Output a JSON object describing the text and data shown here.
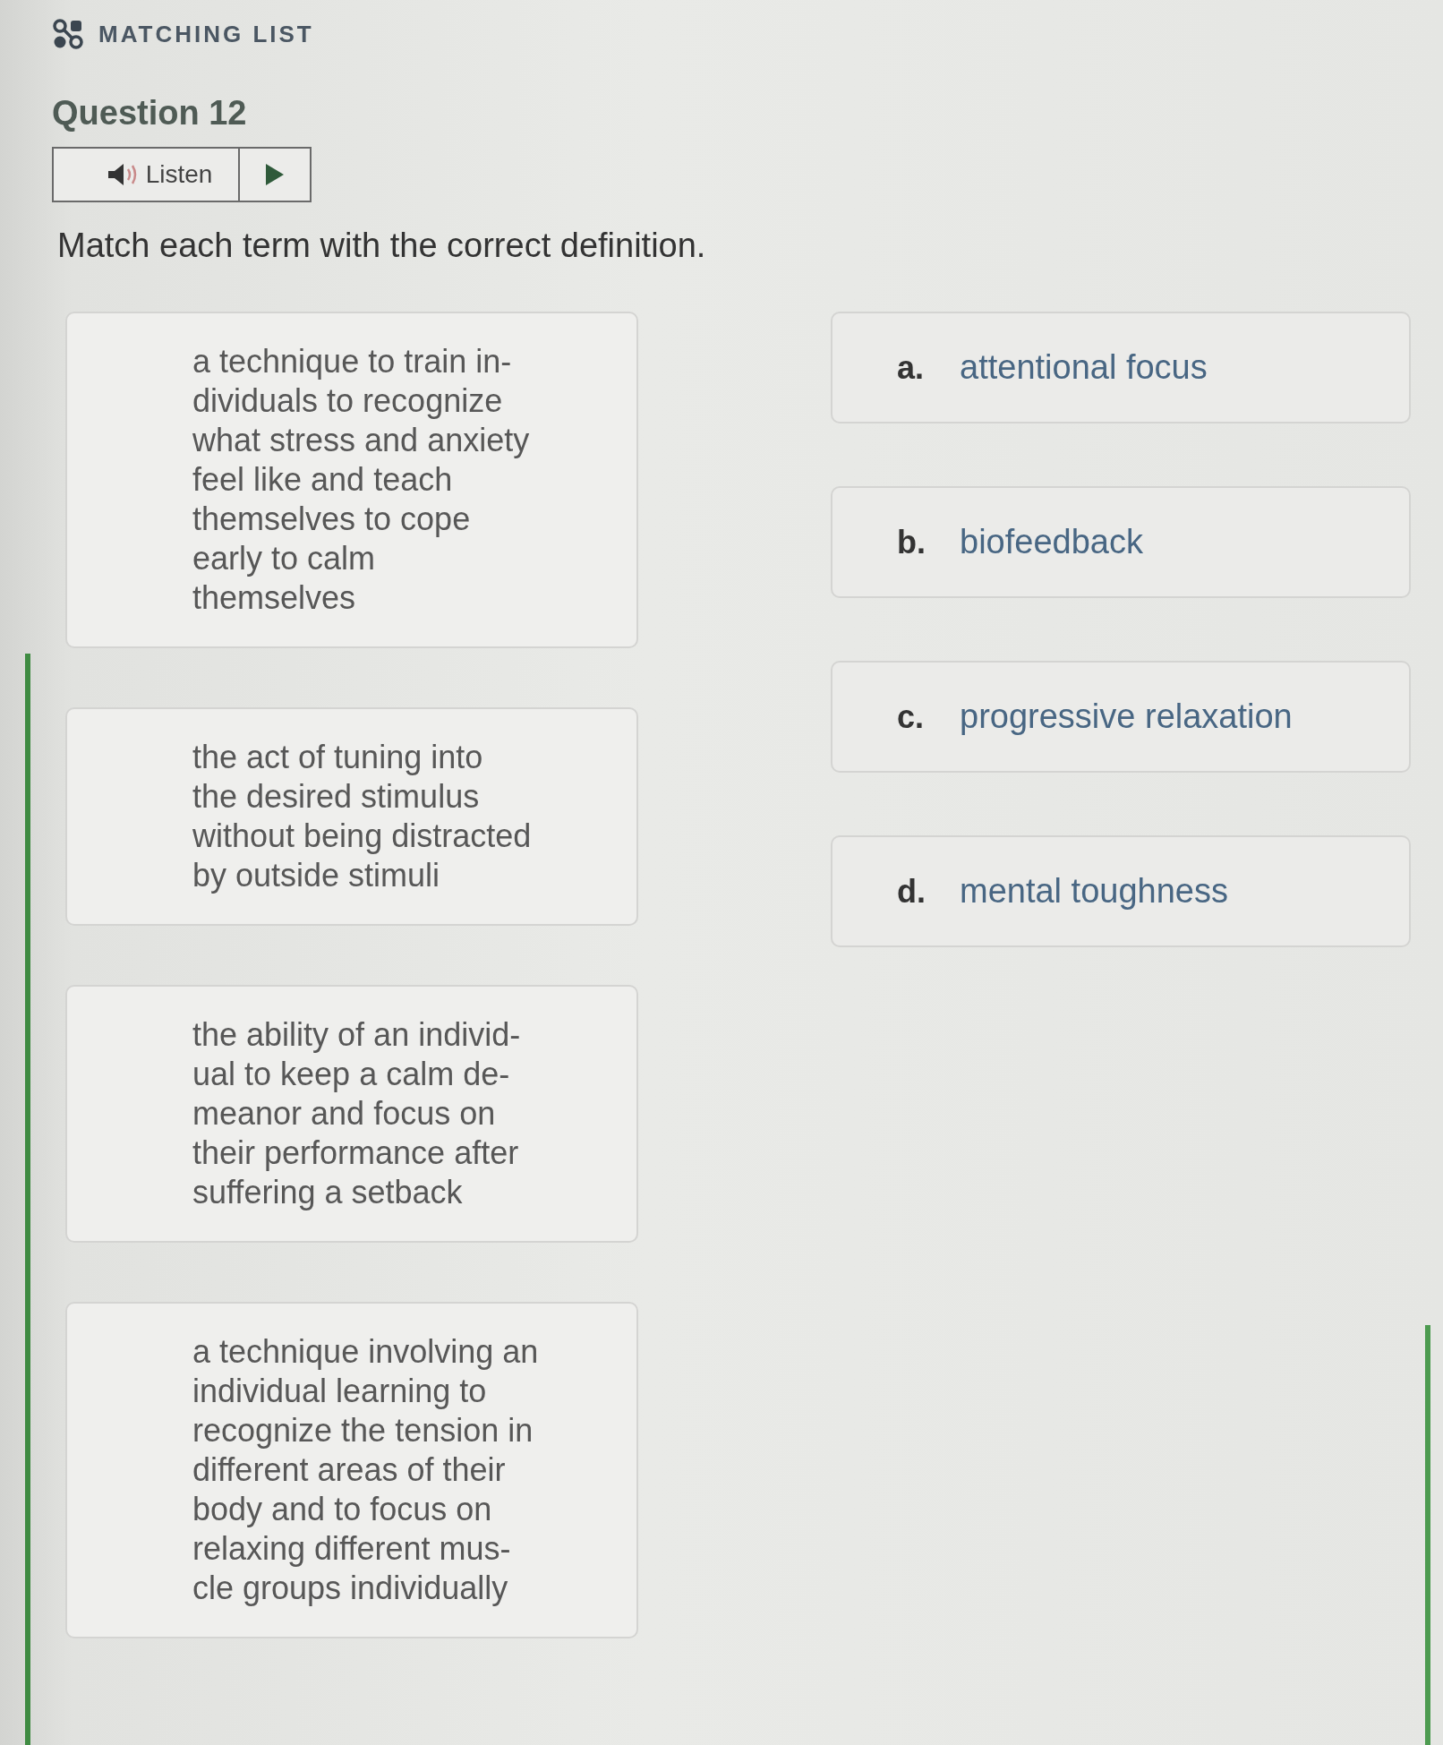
{
  "activity": {
    "type_label": "MATCHING LIST"
  },
  "question": {
    "title": "Question 12",
    "listen": {
      "label": "Listen"
    },
    "prompt": "Match each term with the correct definition."
  },
  "definitions": [
    {
      "lines": [
        "a technique to train in-",
        "dividuals to recognize",
        "what stress and anxiety",
        "feel like and teach",
        "themselves to cope",
        "early to calm",
        "themselves"
      ]
    },
    {
      "lines": [
        "the act of tuning into",
        "the desired stimulus",
        "without being distracted",
        "by outside stimuli"
      ]
    },
    {
      "lines": [
        "the ability of an individ-",
        "ual to keep a calm de-",
        "meanor and focus on",
        "their performance after",
        "suffering a setback"
      ]
    },
    {
      "lines": [
        "a technique involving an",
        "individual learning to",
        "recognize the tension in",
        "different areas of their",
        "body and to focus on",
        "relaxing different mus-",
        "cle groups individually"
      ]
    }
  ],
  "terms": [
    {
      "letter": "a.",
      "text": "attentional focus"
    },
    {
      "letter": "b.",
      "text": "biofeedback"
    },
    {
      "letter": "c.",
      "text": "progressive relaxation"
    },
    {
      "letter": "d.",
      "text": "mental toughness"
    }
  ]
}
